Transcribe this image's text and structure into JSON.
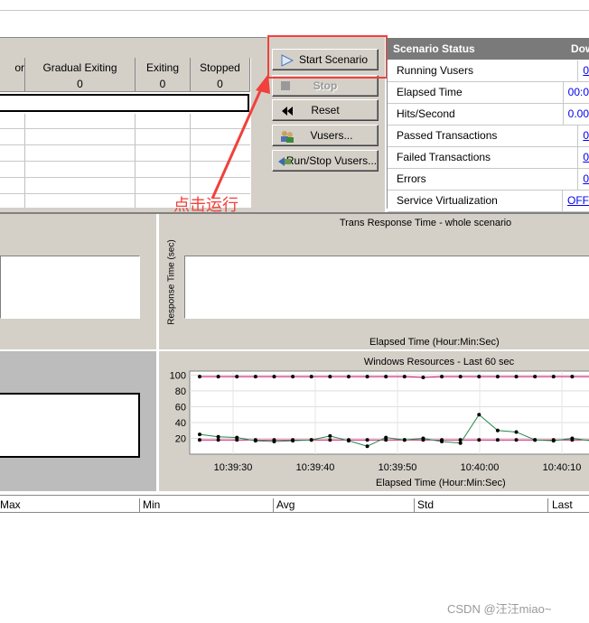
{
  "vuser_grid": {
    "columns": [
      {
        "label": "or",
        "value": ""
      },
      {
        "label": "Gradual Exiting",
        "value": "0"
      },
      {
        "label": "Exiting",
        "value": "0"
      },
      {
        "label": "Stopped",
        "value": "0"
      }
    ]
  },
  "buttons": {
    "start": "Start Scenario",
    "stop": "Stop",
    "reset": "Reset",
    "vusers": "Vusers...",
    "run_stop": "Run/Stop Vusers..."
  },
  "annotation": {
    "text": "点击运行",
    "color": "#f0413c"
  },
  "scenario_status": {
    "title": "Scenario Status",
    "extra_header": "Dow",
    "rows": [
      {
        "name": "Running Vusers",
        "value": "0"
      },
      {
        "name": "Elapsed Time",
        "value": "00:0"
      },
      {
        "name": "Hits/Second",
        "value": "0.00"
      },
      {
        "name": "Passed Transactions",
        "value": "0"
      },
      {
        "name": "Failed Transactions",
        "value": "0"
      },
      {
        "name": "Errors",
        "value": "0"
      },
      {
        "name": "Service Virtualization",
        "value": "OFF"
      }
    ]
  },
  "trans_chart": {
    "title": "Trans Response Time - whole scenario",
    "ylabel": "Response Time (sec)",
    "xlabel": "Elapsed Time (Hour:Min:Sec)"
  },
  "chart_data": {
    "type": "line",
    "title": "Windows Resources - Last 60 sec",
    "xlabel": "Elapsed Time (Hour:Min:Sec)",
    "x_ticks": [
      "10:39:30",
      "10:39:40",
      "10:39:50",
      "10:40:00",
      "10:40:10"
    ],
    "y_ticks": [
      20,
      40,
      60,
      80,
      100
    ],
    "ylim": [
      0,
      105
    ],
    "series": [
      {
        "color": "#cc0066",
        "values": [
          98,
          98,
          98,
          98,
          98,
          98,
          98,
          98,
          98,
          98,
          98,
          98,
          97,
          98,
          98,
          98,
          98,
          98,
          98,
          98,
          98,
          98
        ]
      },
      {
        "color": "#cc0066",
        "values": [
          18,
          18,
          18,
          18,
          18,
          18,
          18,
          18,
          18,
          18,
          18,
          18,
          18,
          18,
          18,
          18,
          18,
          18,
          18,
          18,
          18,
          18
        ]
      },
      {
        "color": "#228844",
        "values": [
          25,
          22,
          21,
          17,
          16,
          17,
          18,
          23,
          17,
          10,
          21,
          18,
          20,
          16,
          14,
          50,
          30,
          28,
          18,
          17,
          20,
          17
        ]
      }
    ]
  },
  "measurement_header": [
    "Max",
    "Min",
    "Avg",
    "Std",
    "Last"
  ],
  "watermark": "CSDN @汪汪miao~"
}
